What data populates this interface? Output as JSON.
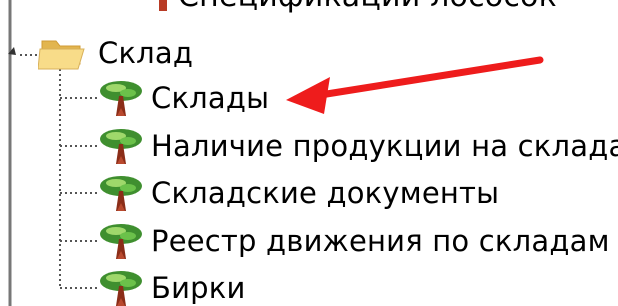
{
  "tree": {
    "partial_label": "Спецификации лососок",
    "folder_label": "Склад",
    "items": [
      {
        "label": "Склады"
      },
      {
        "label": "Наличие продукции на складах"
      },
      {
        "label": "Складские документы"
      },
      {
        "label": "Реестр движения по складам"
      },
      {
        "label": "Бирки"
      }
    ]
  },
  "icons": {
    "folder": "folder-open-icon",
    "item": "tree-icon",
    "expander": "expand-arrow-icon",
    "annotation": "red-arrow-icon"
  },
  "colors": {
    "folder_body": "#f2c85b",
    "folder_front": "#f8dc89",
    "tree_canopy": "#3f8f2f",
    "tree_highlight": "#9fd86b",
    "tree_trunk": "#8b2d18",
    "annotation_arrow": "#ee1c1c",
    "dotted_line": "#555555"
  }
}
